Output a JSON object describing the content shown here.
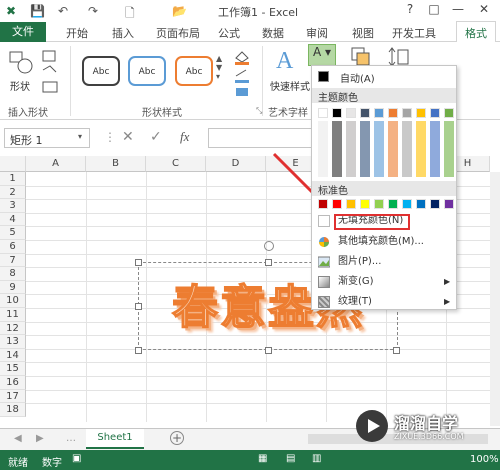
{
  "window": {
    "title": "工作簿1 - Excel",
    "controls": [
      "?",
      "□",
      "—",
      "□",
      "✕"
    ]
  },
  "tabs": {
    "file": "文件",
    "items": [
      "开始",
      "插入",
      "页面布局",
      "公式",
      "数据",
      "审阅",
      "视图",
      "开发工具"
    ],
    "active": "格式"
  },
  "ribbon": {
    "insert_shape_label": "形状",
    "group_insert_shapes": "插入形状",
    "group_shape_styles": "形状样式",
    "style_samples": [
      "Abc",
      "Abc",
      "Abc"
    ],
    "quick_styles_label": "快速样式",
    "group_art_text": "艺术字样"
  },
  "formula_bar": {
    "name_box": "矩形 1",
    "fx": "fx"
  },
  "grid": {
    "columns": [
      "A",
      "B",
      "C",
      "D",
      "E",
      "F",
      "G",
      "H"
    ],
    "rows": [
      "1",
      "2",
      "3",
      "4",
      "5",
      "6",
      "7",
      "8",
      "9",
      "10",
      "11",
      "12",
      "13",
      "14",
      "15",
      "16",
      "17",
      "18"
    ]
  },
  "wordart": {
    "text": "春意盎然"
  },
  "dropdown": {
    "auto_label": "自动(A)",
    "theme_colors_header": "主题颜色",
    "standard_colors_header": "标准色",
    "no_fill_label": "无填充颜色(N)",
    "more_colors_label": "其他填充颜色(M)...",
    "picture_label": "图片(P)...",
    "gradient_label": "渐变(G)",
    "texture_label": "纹理(T)",
    "theme_top_row": [
      "#ffffff",
      "#000000",
      "#e7e6e6",
      "#44546a",
      "#5b9bd5",
      "#ed7d31",
      "#a5a5a5",
      "#ffc000",
      "#4472c4",
      "#70ad47"
    ],
    "standard_colors": [
      "#c00000",
      "#ff0000",
      "#ffc000",
      "#ffff00",
      "#92d050",
      "#00b050",
      "#00b0f0",
      "#0070c0",
      "#002060",
      "#7030a0"
    ]
  },
  "sheets": {
    "active": "Sheet1"
  },
  "status": {
    "ready": "就绪",
    "numlock": "数字",
    "zoom": "100%"
  },
  "watermark": {
    "brand": "溜溜自学",
    "url": "ZIXUE.3D66.COM"
  }
}
